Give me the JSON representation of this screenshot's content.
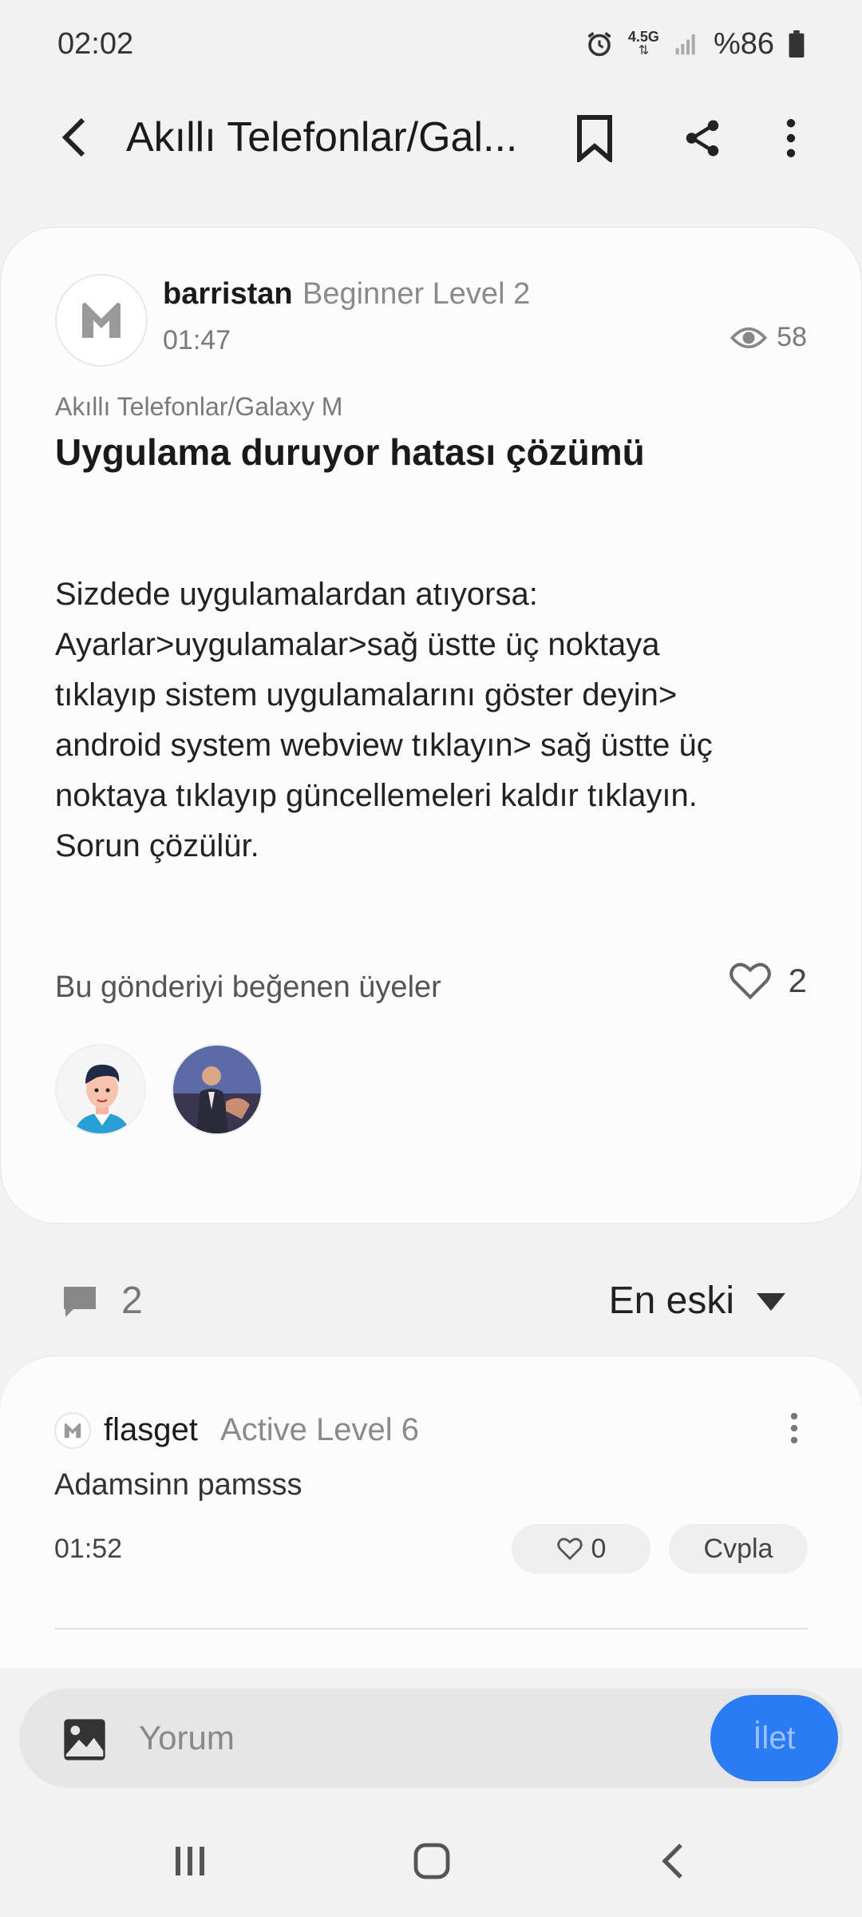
{
  "status_bar": {
    "time": "02:02",
    "battery": "%86",
    "network": "4.5G"
  },
  "app_bar": {
    "title": "Akıllı Telefonlar/Gal..."
  },
  "post": {
    "author": "barristan",
    "level": "Beginner Level 2",
    "time": "01:47",
    "views": "58",
    "category": "Akıllı Telefonlar/Galaxy M",
    "title": "Uygulama duruyor hatası çözümü",
    "body_lines": [
      "Sizdede uygulamalardan atıyorsa:",
      "Ayarlar>uygulamalar>sağ üstte üç noktaya",
      "tıklayıp sistem uygulamalarını göster deyin>",
      "android system webview tıklayın> sağ üstte üç",
      "noktaya tıklayıp güncellemeleri kaldır tıklayın.",
      "Sorun çözülür."
    ],
    "likes_label": "Bu gönderiyi beğenen üyeler",
    "likes_count": "2"
  },
  "comments_header": {
    "count": "2",
    "sort": "En eski"
  },
  "comment": {
    "author": "flasget",
    "level": "Active Level 6",
    "text": "Adamsinn pamsss",
    "time": "01:52",
    "likes": "0",
    "reply_label": "Cvpla"
  },
  "composer": {
    "placeholder": "Yorum",
    "send_label": "İlet"
  },
  "colors": {
    "accent": "#2b7bf2",
    "background": "#f2f2f2",
    "card": "#fcfcfc"
  }
}
